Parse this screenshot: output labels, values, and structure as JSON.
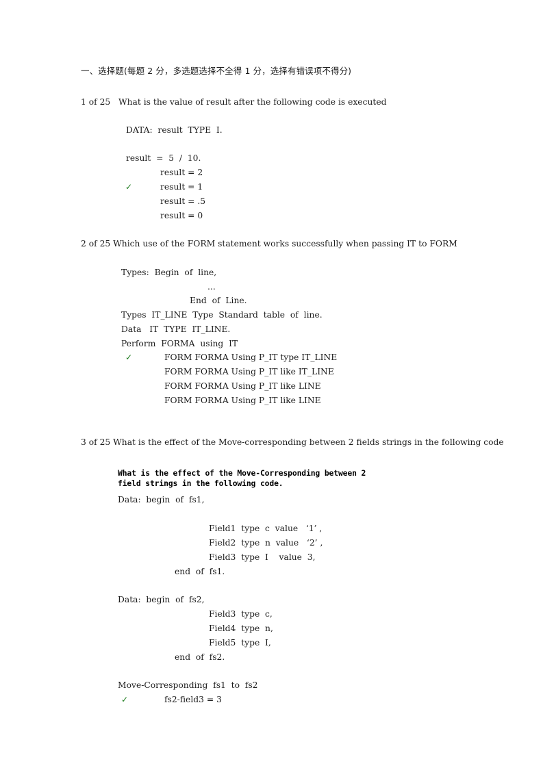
{
  "document": {
    "section_heading": "一、选择题(每题 2 分，多选题选择不全得 1 分，选择有错误项不得分)",
    "check_color": "#1a7a1a",
    "check_glyph": "✓"
  },
  "questions": [
    {
      "number": "1 of 25",
      "prompt": "What is the value of result after the following code is executed",
      "code": [
        "DATA:  result  TYPE  I.",
        "result  =  5  /  10."
      ],
      "options": [
        {
          "text": "result = 2",
          "checked": false
        },
        {
          "text": "result = 1",
          "checked": true
        },
        {
          "text": "result = .5",
          "checked": false
        },
        {
          "text": "result = 0",
          "checked": false
        }
      ]
    },
    {
      "number": "2 of 25",
      "prompt": "Which use of the FORM statement works successfully when passing IT to FORM",
      "code": [
        "Types:  Begin  of  line,",
        "...",
        "End  of  Line.",
        "Types  IT_LINE  Type  Standard  table  of  line.",
        "Data   IT  TYPE  IT_LINE.",
        "Perform  FORMA  using  IT"
      ],
      "options": [
        {
          "text": "FORM FORMA Using P_IT type IT_LINE",
          "checked": true
        },
        {
          "text": "FORM FORMA Using P_IT like IT_LINE",
          "checked": false
        },
        {
          "text": "FORM FORMA Using P_IT like LINE",
          "checked": false
        },
        {
          "text": "FORM FORMA Using P_IT like LINE",
          "checked": false
        }
      ]
    },
    {
      "number": "3 of 25",
      "prompt": "What is the effect of the Move-corresponding between 2 fields strings in the following code",
      "bold_insert": [
        "What is the effect of the Move-Corresponding between 2",
        "field strings in the following code."
      ],
      "code": [
        "Data:  begin  of  fs1,",
        "Field1  type  c  value   ‘1’ ,",
        "Field2  type  n  value   ‘2’ ,",
        "Field3  type  I    value  3,",
        "end  of  fs1.",
        "Data:  begin  of  fs2,",
        "Field3  type  c,",
        "Field4  type  n,",
        "Field5  type  I,",
        "end  of  fs2.",
        "Move-Corresponding  fs1  to  fs2"
      ],
      "options": [
        {
          "text": "fs2-field3 = 3",
          "checked": true
        }
      ]
    }
  ]
}
